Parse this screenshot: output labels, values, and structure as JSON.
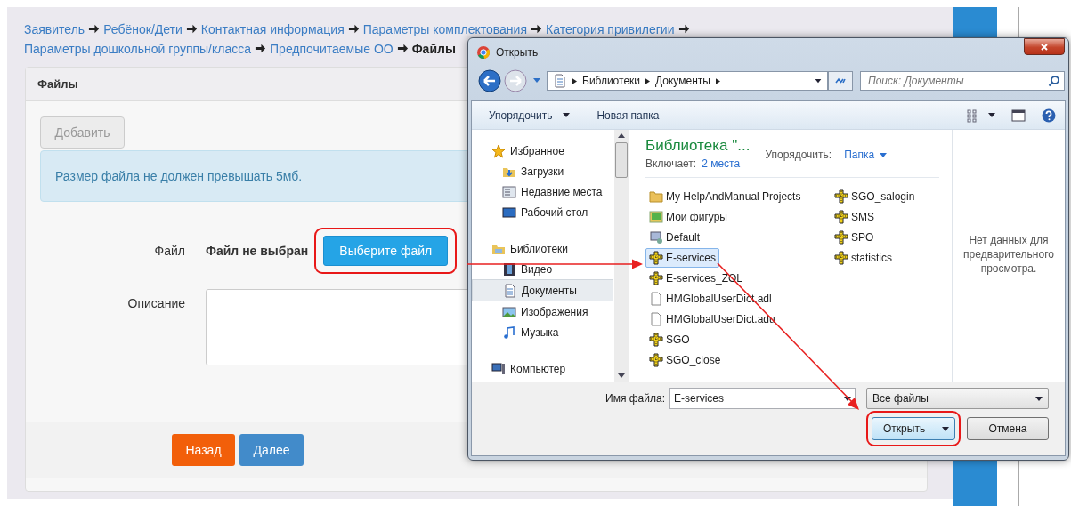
{
  "breadcrumb": {
    "links": [
      "Заявитель",
      "Ребёнок/Дети",
      "Контактная информация",
      "Параметры комплектования",
      "Категория привилегии",
      "Параметры дошкольной группы/класса",
      "Предпочитаемые ОО"
    ],
    "current": "Файлы"
  },
  "card": {
    "title": "Файлы",
    "add_button": {
      "label": "Добавить",
      "disabled": true
    },
    "alert": "Размер файла не должен превышать 5мб.",
    "file_field": {
      "label": "Файл",
      "status": "Файл не выбран",
      "button": "Выберите файл"
    },
    "description_field": {
      "label": "Описание"
    },
    "buttons": [
      {
        "label": "Назад",
        "kind": "back"
      },
      {
        "label": "Далее",
        "kind": "next"
      }
    ]
  },
  "dialog": {
    "title": "Открыть",
    "path": [
      "Библиотеки",
      "Документы"
    ],
    "search": {
      "placeholder": "Поиск: Документы"
    },
    "toolbar": [
      {
        "label": "Упорядочить",
        "dropdown": true
      },
      {
        "label": "Новая папка",
        "dropdown": false
      }
    ],
    "navigation": [
      {
        "label": "Избранное",
        "kind": "star",
        "selected": false,
        "children": [
          {
            "label": "Загрузки",
            "kind": "downloads",
            "selected": false
          },
          {
            "label": "Недавние места",
            "kind": "recent",
            "selected": false
          },
          {
            "label": "Рабочий стол",
            "kind": "desktop",
            "selected": false
          }
        ]
      },
      {
        "label": "Библиотеки",
        "kind": "library",
        "selected": false,
        "children": [
          {
            "label": "Видео",
            "kind": "video",
            "selected": false
          },
          {
            "label": "Документы",
            "kind": "documents",
            "selected": true
          },
          {
            "label": "Изображения",
            "kind": "pictures",
            "selected": false
          },
          {
            "label": "Музыка",
            "kind": "music",
            "selected": false
          }
        ]
      },
      {
        "label": "Компьютер",
        "kind": "computer",
        "selected": false
      }
    ],
    "library": {
      "title": "Библиотека \"...",
      "includes_label": "Включает:",
      "includes_link": "2 места",
      "arrange_label": "Упорядочить:",
      "arrange_value": "Папка"
    },
    "files": [
      {
        "name": "My HelpAndManual Projects",
        "kind": "folder",
        "selected": false
      },
      {
        "name": "Мои фигуры",
        "kind": "shapes",
        "selected": false
      },
      {
        "name": "Default",
        "kind": "default",
        "selected": false
      },
      {
        "name": "E-services",
        "kind": "helpfile",
        "selected": true
      },
      {
        "name": "E-services_ZOL",
        "kind": "helpfile",
        "selected": false
      },
      {
        "name": "HMGlobalUserDict.adl",
        "kind": "file",
        "selected": false
      },
      {
        "name": "HMGlobalUserDict.adu",
        "kind": "file",
        "selected": false
      },
      {
        "name": "SGO",
        "kind": "helpfile",
        "selected": false
      },
      {
        "name": "SGO_close",
        "kind": "helpfile",
        "selected": false
      },
      {
        "name": "SGO_salogin",
        "kind": "helpfile",
        "selected": false
      },
      {
        "name": "SMS",
        "kind": "helpfile",
        "selected": false
      },
      {
        "name": "SPO",
        "kind": "helpfile",
        "selected": false
      },
      {
        "name": "statistics",
        "kind": "helpfile",
        "selected": false
      }
    ],
    "preview_text": "Нет данных для предварительного просмотра.",
    "file_name": {
      "label": "Имя файла:",
      "value": "E-services"
    },
    "file_type": "Все файлы",
    "buttons": [
      {
        "label": "Открыть",
        "kind": "primary"
      },
      {
        "label": "Отмена",
        "kind": "cancel"
      }
    ]
  }
}
